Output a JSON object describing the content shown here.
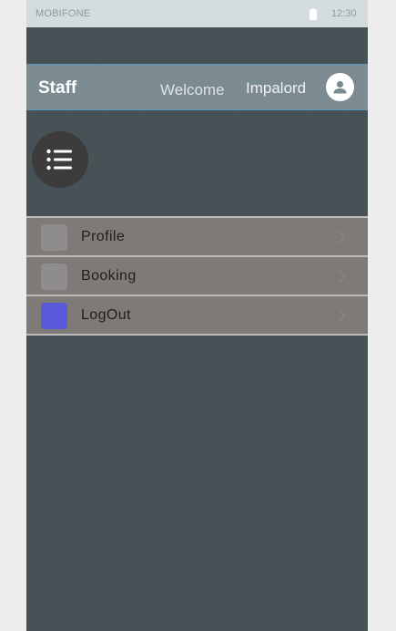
{
  "status_bar": {
    "carrier": "MOBIFONE",
    "time": "12:30"
  },
  "header": {
    "title": "Staff",
    "welcome": "Welcome",
    "username": "Impalord",
    "avatar_icon": "person-icon"
  },
  "menu_button": {
    "icon": "list-menu-icon"
  },
  "menu": {
    "items": [
      {
        "label": "Profile",
        "icon_color": "#8e8c8c"
      },
      {
        "label": "Booking",
        "icon_color": "#8e8c8c"
      },
      {
        "label": "LogOut",
        "icon_color": "#5a59d9"
      }
    ]
  },
  "colors": {
    "background": "#475256",
    "header": "#7c8b92",
    "menu_item": "#7d7a77",
    "fab": "#3d3b3b"
  }
}
